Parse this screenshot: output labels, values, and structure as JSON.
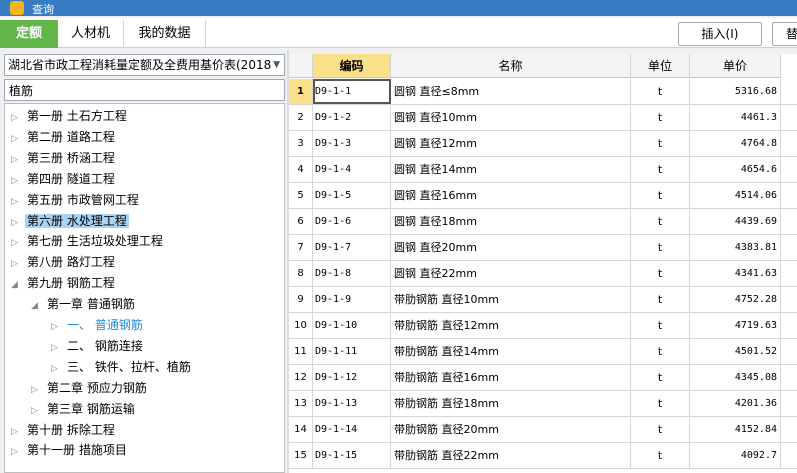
{
  "window": {
    "title": "查询"
  },
  "tabs": [
    "定额",
    "人材机",
    "我的数据"
  ],
  "toolbar": {
    "insert_label": "插入(I)",
    "replace_label": "替"
  },
  "library": {
    "selected": "湖北省市政工程消耗量定额及全费用基价表(2018"
  },
  "search": {
    "value": "植筋",
    "placeholder": ""
  },
  "tree": [
    {
      "label": "第一册 土石方工程",
      "level": 0,
      "expanded": false
    },
    {
      "label": "第二册 道路工程",
      "level": 0,
      "expanded": false
    },
    {
      "label": "第三册 桥涵工程",
      "level": 0,
      "expanded": false
    },
    {
      "label": "第四册 隧道工程",
      "level": 0,
      "expanded": false
    },
    {
      "label": "第五册 市政管网工程",
      "level": 0,
      "expanded": false
    },
    {
      "label": "第六册 水处理工程",
      "level": 0,
      "expanded": false,
      "selected": true
    },
    {
      "label": "第七册 生活垃圾处理工程",
      "level": 0,
      "expanded": false
    },
    {
      "label": "第八册 路灯工程",
      "level": 0,
      "expanded": false
    },
    {
      "label": "第九册 钢筋工程",
      "level": 0,
      "expanded": true
    },
    {
      "label": "第一章 普通钢筋",
      "level": 1,
      "expanded": true
    },
    {
      "label": "一、 普通钢筋",
      "level": 2,
      "expanded": false,
      "highlight": true
    },
    {
      "label": "二、 钢筋连接",
      "level": 2,
      "expanded": false
    },
    {
      "label": "三、 铁件、拉杆、植筋",
      "level": 2,
      "expanded": false
    },
    {
      "label": "第二章 预应力钢筋",
      "level": 1,
      "expanded": false
    },
    {
      "label": "第三章 钢筋运输",
      "level": 1,
      "expanded": false
    },
    {
      "label": "第十册 拆除工程",
      "level": 0,
      "expanded": false
    },
    {
      "label": "第十一册 措施项目",
      "level": 0,
      "expanded": false
    }
  ],
  "grid": {
    "headers": {
      "index": "",
      "code": "编码",
      "name": "名称",
      "unit": "单位",
      "price": "单价"
    },
    "rows": [
      {
        "idx": "1",
        "code": "D9-1-1",
        "name": "圆钢 直径≤8mm",
        "unit": "t",
        "price": "5316.68"
      },
      {
        "idx": "2",
        "code": "D9-1-2",
        "name": "圆钢 直径10mm",
        "unit": "t",
        "price": "4461.3"
      },
      {
        "idx": "3",
        "code": "D9-1-3",
        "name": "圆钢 直径12mm",
        "unit": "t",
        "price": "4764.8"
      },
      {
        "idx": "4",
        "code": "D9-1-4",
        "name": "圆钢 直径14mm",
        "unit": "t",
        "price": "4654.6"
      },
      {
        "idx": "5",
        "code": "D9-1-5",
        "name": "圆钢 直径16mm",
        "unit": "t",
        "price": "4514.06"
      },
      {
        "idx": "6",
        "code": "D9-1-6",
        "name": "圆钢 直径18mm",
        "unit": "t",
        "price": "4439.69"
      },
      {
        "idx": "7",
        "code": "D9-1-7",
        "name": "圆钢 直径20mm",
        "unit": "t",
        "price": "4383.81"
      },
      {
        "idx": "8",
        "code": "D9-1-8",
        "name": "圆钢 直径22mm",
        "unit": "t",
        "price": "4341.63"
      },
      {
        "idx": "9",
        "code": "D9-1-9",
        "name": "带肋钢筋 直径10mm",
        "unit": "t",
        "price": "4752.28"
      },
      {
        "idx": "10",
        "code": "D9-1-10",
        "name": "带肋钢筋 直径12mm",
        "unit": "t",
        "price": "4719.63"
      },
      {
        "idx": "11",
        "code": "D9-1-11",
        "name": "带肋钢筋 直径14mm",
        "unit": "t",
        "price": "4501.52"
      },
      {
        "idx": "12",
        "code": "D9-1-12",
        "name": "带肋钢筋 直径16mm",
        "unit": "t",
        "price": "4345.08"
      },
      {
        "idx": "13",
        "code": "D9-1-13",
        "name": "带肋钢筋 直径18mm",
        "unit": "t",
        "price": "4201.36"
      },
      {
        "idx": "14",
        "code": "D9-1-14",
        "name": "带肋钢筋 直径20mm",
        "unit": "t",
        "price": "4152.84"
      },
      {
        "idx": "15",
        "code": "D9-1-15",
        "name": "带肋钢筋 直径22mm",
        "unit": "t",
        "price": "4092.7"
      }
    ]
  },
  "colors": {
    "active_tab": "#62b64a",
    "selection": "#a9d2f5",
    "sorted_header": "#fbe08a",
    "link_blue": "#1e8be0"
  },
  "icons": {
    "app": "app-logo-icon",
    "expand": "triangle-right-icon",
    "collapse": "triangle-down-icon",
    "dropdown": "chevron-down-icon"
  }
}
